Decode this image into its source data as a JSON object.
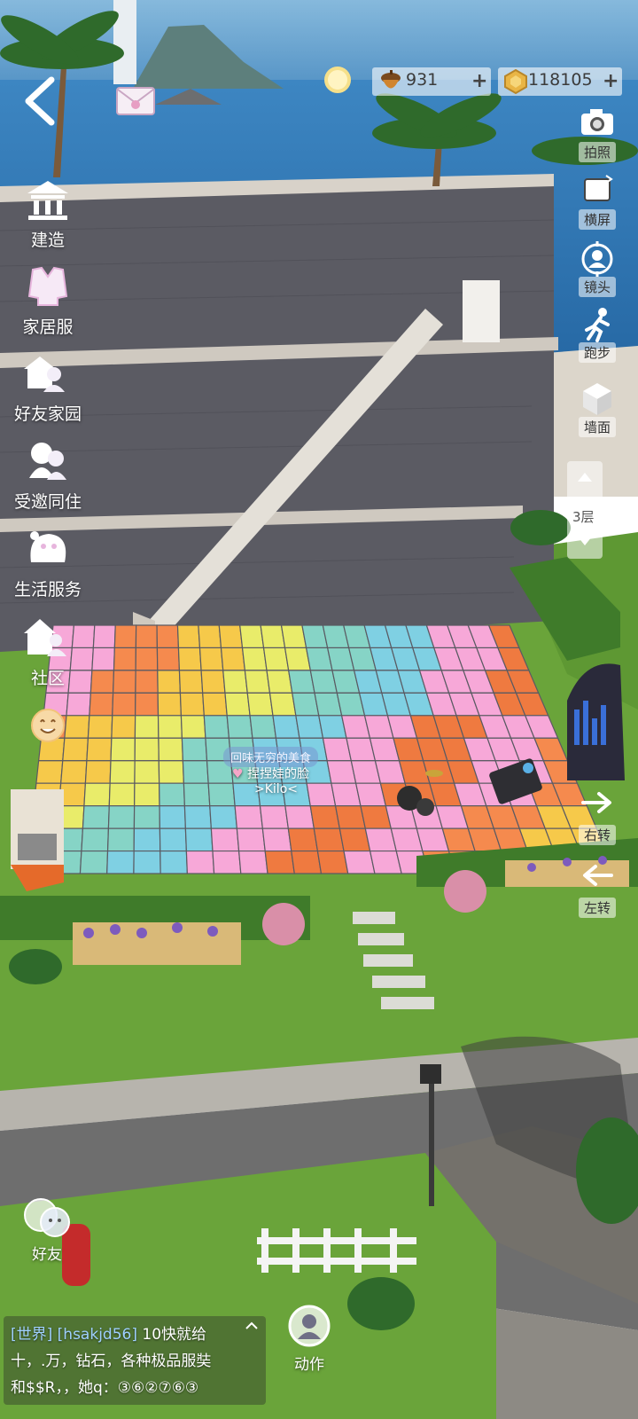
{
  "resources": {
    "acorn_count": "931",
    "coin_count": "118105",
    "plus_symbol": "+"
  },
  "left_menu": [
    {
      "label": "建造",
      "icon": "building-icon"
    },
    {
      "label": "家居服",
      "icon": "outfit-icon"
    },
    {
      "label": "好友家园",
      "icon": "friend-home-icon"
    },
    {
      "label": "受邀同住",
      "icon": "invite-cohabit-icon"
    },
    {
      "label": "生活服务",
      "icon": "life-service-icon"
    },
    {
      "label": "社区",
      "icon": "community-icon"
    }
  ],
  "right_menu": [
    {
      "label": "拍照",
      "icon": "camera-icon"
    },
    {
      "label": "横屏",
      "icon": "rotate-screen-icon"
    },
    {
      "label": "镜头",
      "icon": "lens-icon"
    },
    {
      "label": "跑步",
      "icon": "run-icon"
    },
    {
      "label": "墙面",
      "icon": "wall-cube-icon"
    }
  ],
  "floor": {
    "label": "3层"
  },
  "turn": {
    "right_label": "右转",
    "left_label": "左转"
  },
  "friends": {
    "label": "好友"
  },
  "action": {
    "label": "动作"
  },
  "player": {
    "title": "回味无穷的美食",
    "name": "捏捏娃的脸",
    "tag": ">Kilo<"
  },
  "chat": {
    "channel": "[世界]",
    "sender": "[hsakjd56]",
    "line1_text": "10快就给",
    "line2": "十，.万，钻石，各种极品服奘",
    "line3": "和$$R，，她q：③⑥②⑦⑥③"
  },
  "colors": {
    "sea": "#3f7fb8",
    "wall": "#5a5a62",
    "lawn": "#6aa43a",
    "road": "#6e6e6e"
  }
}
